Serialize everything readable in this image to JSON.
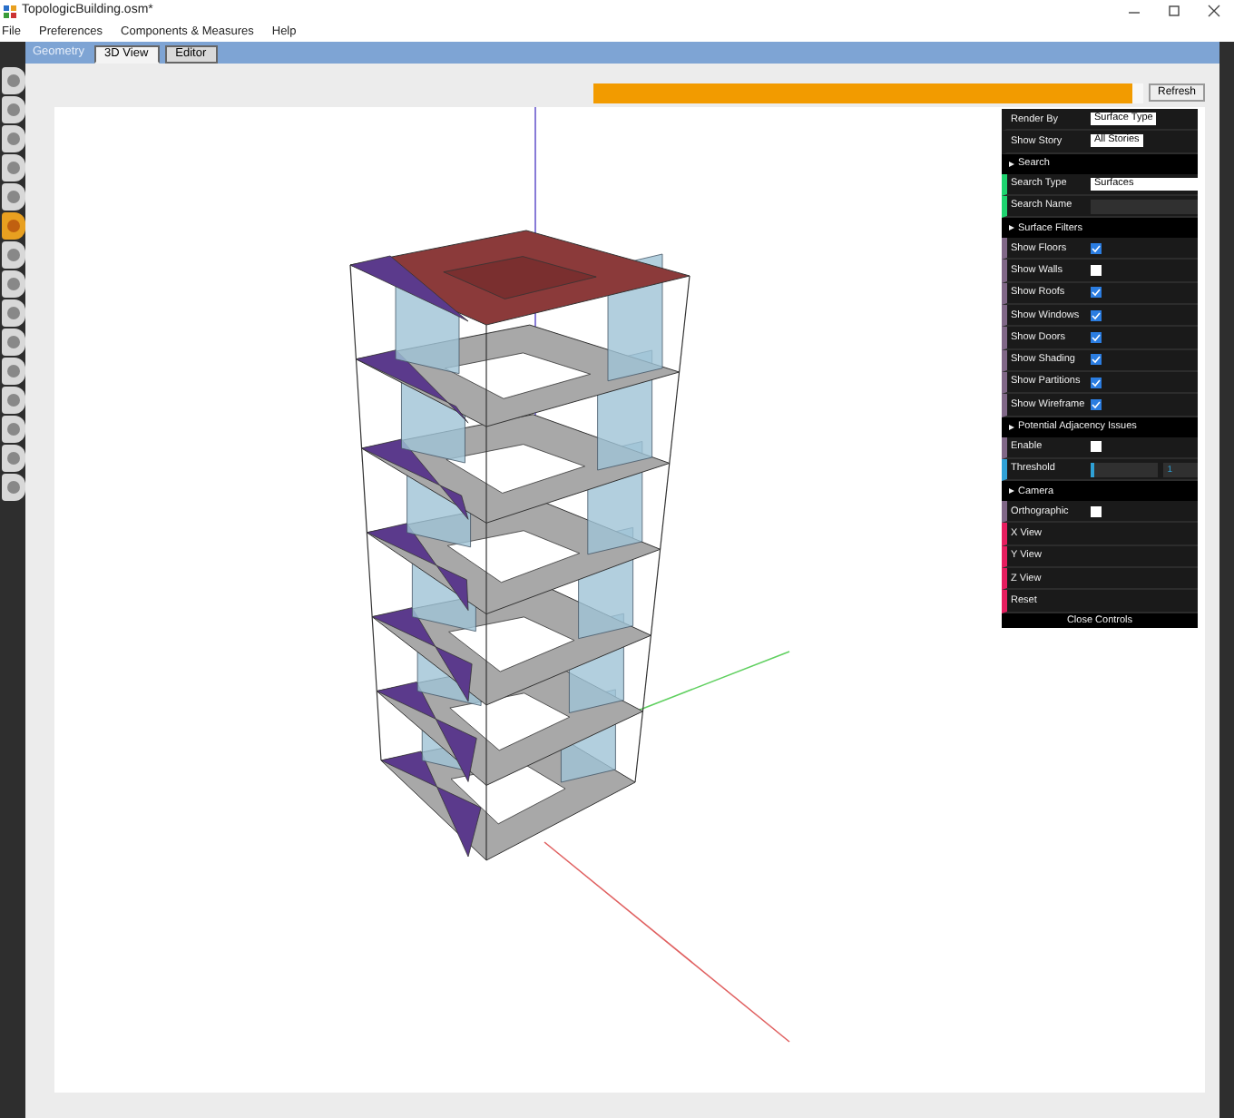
{
  "window": {
    "title": "TopologicBuilding.osm*"
  },
  "menu": [
    "File",
    "Preferences",
    "Components & Measures",
    "Help"
  ],
  "section": {
    "title": "Geometry"
  },
  "tabs": [
    {
      "label": "3D View",
      "selected": true
    },
    {
      "label": "Editor",
      "selected": false
    }
  ],
  "sidebar": {
    "tools": [
      {
        "selected": false
      },
      {
        "selected": false
      },
      {
        "selected": false
      },
      {
        "selected": false
      },
      {
        "selected": false
      },
      {
        "selected": true
      },
      {
        "selected": false
      },
      {
        "selected": false
      },
      {
        "selected": false
      },
      {
        "selected": false
      },
      {
        "selected": false
      },
      {
        "selected": false
      },
      {
        "selected": false
      },
      {
        "selected": false
      },
      {
        "selected": false
      }
    ]
  },
  "progress": {
    "level": 0.98
  },
  "refresh_button": "Refresh",
  "controls": {
    "groups": [
      {
        "rows": [
          {
            "kind": "select",
            "label": "Render By",
            "value": "Surface Type"
          },
          {
            "kind": "select",
            "label": "Show Story",
            "value": "All Stories"
          }
        ]
      },
      {
        "title": "Search",
        "rows": [
          {
            "kind": "select",
            "label": "Search Type",
            "value": "Surfaces"
          },
          {
            "kind": "text",
            "label": "Search Name"
          }
        ]
      },
      {
        "title": "Surface Filters",
        "rows": [
          {
            "kind": "checkbox",
            "label": "Show Floors",
            "checked": true
          },
          {
            "kind": "checkbox",
            "label": "Show Walls",
            "checked": false
          },
          {
            "kind": "checkbox",
            "label": "Show Roofs",
            "checked": true
          },
          {
            "kind": "checkbox",
            "label": "Show Windows",
            "checked": true
          },
          {
            "kind": "checkbox",
            "label": "Show Doors",
            "checked": true
          },
          {
            "kind": "checkbox",
            "label": "Show Shading",
            "checked": true
          },
          {
            "kind": "checkbox",
            "label": "Show Partitions",
            "checked": true
          },
          {
            "kind": "checkbox",
            "label": "Show Wireframe",
            "checked": true
          }
        ]
      },
      {
        "title": "Potential Adjacency Issues",
        "rows": [
          {
            "kind": "checkbox",
            "label": "Enable",
            "checked": false
          },
          {
            "kind": "slider",
            "label": "Threshold",
            "level": 0.05,
            "value": "1"
          }
        ]
      },
      {
        "title": "Camera",
        "rows": [
          {
            "kind": "checkbox",
            "label": "Orthographic",
            "checked": false
          },
          {
            "kind": "button",
            "label": "X View"
          },
          {
            "kind": "button",
            "label": "Y View"
          },
          {
            "kind": "button",
            "label": "Z View"
          },
          {
            "kind": "button",
            "label": "Reset"
          }
        ]
      }
    ],
    "close_button": "Close Controls"
  }
}
